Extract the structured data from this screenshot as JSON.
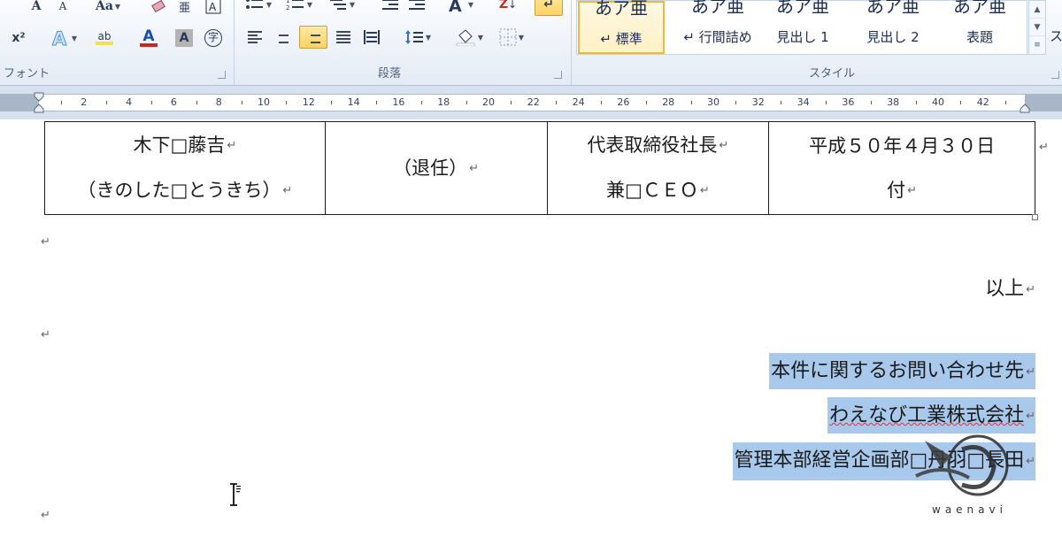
{
  "ribbon": {
    "groups": {
      "font": "フォント",
      "paragraph": "段落",
      "styles": "スタイル"
    },
    "font_buttons": {
      "grow_font": "A",
      "shrink_font": "A",
      "change_case": "Aa",
      "superscript": "x²",
      "highlight_text": "ab",
      "font_color": "A",
      "char_shading": "A",
      "enclose_char": "字"
    },
    "sort_button": "Z",
    "styles": [
      {
        "sample": "あア亜",
        "name": "↵ 標準",
        "selected": true
      },
      {
        "sample": "あア亜",
        "name": "↵ 行間詰め",
        "selected": false
      },
      {
        "sample": "あア亜",
        "name": "見出し 1",
        "selected": false
      },
      {
        "sample": "あア亜",
        "name": "見出し 2",
        "selected": false
      },
      {
        "sample": "あア亜",
        "name": "表題",
        "selected": false
      }
    ],
    "edge_text": "ス",
    "highlight_color": "#f2e24a",
    "font_color": "#c42b1c",
    "accent_active": "#ffd25f"
  },
  "ruler": {
    "labels": [
      "2",
      "4",
      "6",
      "8",
      "10",
      "12",
      "14",
      "16",
      "18",
      "20",
      "22",
      "24",
      "26",
      "28",
      "30",
      "32",
      "34",
      "36",
      "38",
      "40",
      "42"
    ]
  },
  "document": {
    "table": {
      "cells": [
        {
          "lines": [
            "木下□藤吉",
            "（きのした□とうきち）"
          ]
        },
        {
          "lines": [
            "（退任）"
          ]
        },
        {
          "lines": [
            "代表取締役社長",
            "兼□ＣＥＯ"
          ]
        },
        {
          "lines": [
            "平成５０年４月３０日",
            "付"
          ]
        }
      ]
    },
    "closing": "以上",
    "contact": {
      "line1": "本件に関するお問い合わせ先",
      "line2": "わえなび工業株式会社",
      "line3": "管理本部経営企画部□丹羽□長田"
    },
    "paragraph_mark": "↵",
    "selection_color": "#a8c8ec"
  },
  "watermark": {
    "text": "waenavi"
  }
}
